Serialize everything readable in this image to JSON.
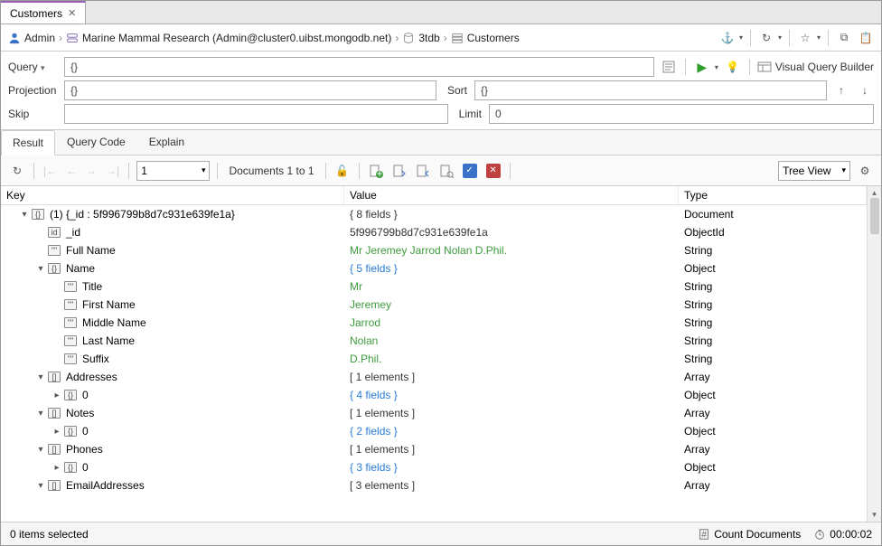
{
  "tab": {
    "title": "Customers"
  },
  "breadcrumb": {
    "user": "Admin",
    "connection": "Marine Mammal Research (Admin@cluster0.uibst.mongodb.net)",
    "database": "3tdb",
    "collection": "Customers"
  },
  "query": {
    "query_label": "Query",
    "query_value": "{}",
    "projection_label": "Projection",
    "projection_value": "{}",
    "sort_label": "Sort",
    "sort_value": "{}",
    "skip_label": "Skip",
    "skip_value": "",
    "limit_label": "Limit",
    "limit_value": "0",
    "vqb_label": "Visual Query Builder"
  },
  "result_tabs": {
    "result": "Result",
    "query_code": "Query Code",
    "explain": "Explain"
  },
  "result_toolbar": {
    "page_value": "1",
    "doc_range": "Documents 1 to 1",
    "view_mode": "Tree View"
  },
  "columns": {
    "key": "Key",
    "value": "Value",
    "type": "Type"
  },
  "tree": [
    {
      "depth": 0,
      "toggle": "▾",
      "icon": "{}",
      "key": "(1) {_id : 5f996799b8d7c931e639fe1a}",
      "value": "{ 8 fields }",
      "vclass": "val-plain",
      "type": "Document"
    },
    {
      "depth": 1,
      "toggle": "",
      "icon": "id",
      "key": "_id",
      "value": "5f996799b8d7c931e639fe1a",
      "vclass": "val-plain",
      "type": "ObjectId"
    },
    {
      "depth": 1,
      "toggle": "",
      "icon": "\"\"",
      "key": "Full Name",
      "value": "Mr Jeremey Jarrod Nolan D.Phil.",
      "vclass": "val-str",
      "type": "String"
    },
    {
      "depth": 1,
      "toggle": "▾",
      "icon": "{}",
      "key": "Name",
      "value": "{ 5 fields }",
      "vclass": "val-obj",
      "type": "Object"
    },
    {
      "depth": 2,
      "toggle": "",
      "icon": "\"\"",
      "key": "Title",
      "value": "Mr",
      "vclass": "val-str",
      "type": "String"
    },
    {
      "depth": 2,
      "toggle": "",
      "icon": "\"\"",
      "key": "First Name",
      "value": "Jeremey",
      "vclass": "val-str",
      "type": "String"
    },
    {
      "depth": 2,
      "toggle": "",
      "icon": "\"\"",
      "key": "Middle Name",
      "value": "Jarrod",
      "vclass": "val-str",
      "type": "String"
    },
    {
      "depth": 2,
      "toggle": "",
      "icon": "\"\"",
      "key": "Last Name",
      "value": "Nolan",
      "vclass": "val-str",
      "type": "String"
    },
    {
      "depth": 2,
      "toggle": "",
      "icon": "\"\"",
      "key": "Suffix",
      "value": "D.Phil.",
      "vclass": "val-str",
      "type": "String"
    },
    {
      "depth": 1,
      "toggle": "▾",
      "icon": "[]",
      "key": "Addresses",
      "value": "[ 1 elements ]",
      "vclass": "val-plain",
      "type": "Array"
    },
    {
      "depth": 2,
      "toggle": "▸",
      "icon": "{}",
      "key": "0",
      "value": "{ 4 fields }",
      "vclass": "val-obj",
      "type": "Object"
    },
    {
      "depth": 1,
      "toggle": "▾",
      "icon": "[]",
      "key": "Notes",
      "value": "[ 1 elements ]",
      "vclass": "val-plain",
      "type": "Array"
    },
    {
      "depth": 2,
      "toggle": "▸",
      "icon": "{}",
      "key": "0",
      "value": "{ 2 fields }",
      "vclass": "val-obj",
      "type": "Object"
    },
    {
      "depth": 1,
      "toggle": "▾",
      "icon": "[]",
      "key": "Phones",
      "value": "[ 1 elements ]",
      "vclass": "val-plain",
      "type": "Array"
    },
    {
      "depth": 2,
      "toggle": "▸",
      "icon": "{}",
      "key": "0",
      "value": "{ 3 fields }",
      "vclass": "val-obj",
      "type": "Object"
    },
    {
      "depth": 1,
      "toggle": "▾",
      "icon": "[]",
      "key": "EmailAddresses",
      "value": "[ 3 elements ]",
      "vclass": "val-plain",
      "type": "Array"
    }
  ],
  "status": {
    "selection": "0 items selected",
    "count_docs": "Count Documents",
    "elapsed": "00:00:02"
  }
}
